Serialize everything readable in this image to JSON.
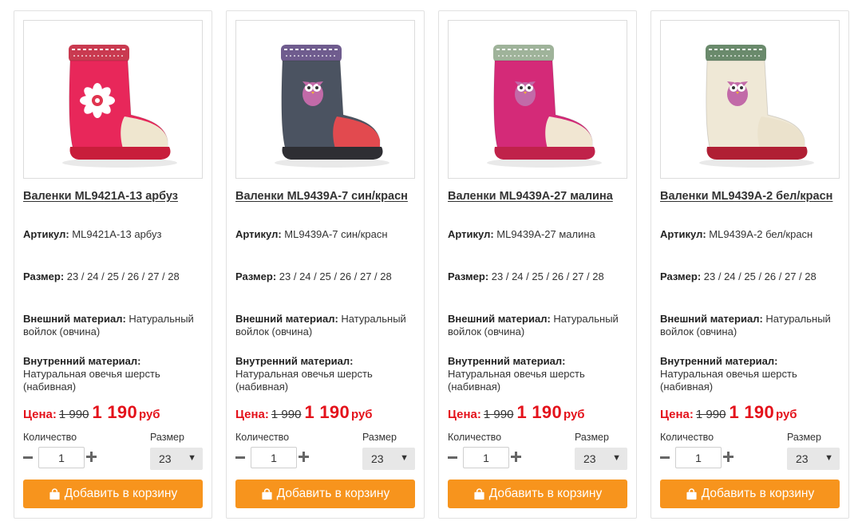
{
  "labels": {
    "article": "Артикул:",
    "size": "Размер:",
    "outer": "Внешний материал:",
    "inner": "Внутренний материал:",
    "price": "Цена:",
    "currency": "руб",
    "quantity": "Количество",
    "size_select": "Размер",
    "add_to_cart": "Добавить в корзину"
  },
  "colors": {
    "price_red": "#e4121b",
    "button_orange": "#f7941d"
  },
  "products": [
    {
      "title": "Валенки ML9421A-13 арбуз",
      "article": "ML9421A-13 арбуз",
      "sizes": "23 / 24 / 25 / 26 / 27 / 28",
      "outer": "Натуральный войлок (овчина)",
      "inner": "Натуральная овечья шерсть (набивная)",
      "old_price": "1 990",
      "new_price": "1 190",
      "quantity": "1",
      "selected_size": "23",
      "image": "pink boot with white flower",
      "boot_color": "#e8275a",
      "toe_color": "#efe6cf",
      "sole_color": "#c81e3b",
      "cuff_color": "#c93a50"
    },
    {
      "title": "Валенки ML9439A-7 син/красн",
      "article": "ML9439A-7 син/красн",
      "sizes": "23 / 24 / 25 / 26 / 27 / 28",
      "outer": "Натуральный войлок (овчина)",
      "inner": "Натуральная овечья шерсть (набивная)",
      "old_price": "1 990",
      "new_price": "1 190",
      "quantity": "1",
      "selected_size": "23",
      "image": "blue-grey boot with owl",
      "boot_color": "#4b5361",
      "toe_color": "#e24a4f",
      "sole_color": "#2e2e33",
      "cuff_color": "#6f5c8e"
    },
    {
      "title": "Валенки ML9439A-27 малина",
      "article": "ML9439A-27 малина",
      "sizes": "23 / 24 / 25 / 26 / 27 / 28",
      "outer": "Натуральный войлок (овчина)",
      "inner": "Натуральная овечья шерсть (набивная)",
      "old_price": "1 990",
      "new_price": "1 190",
      "quantity": "1",
      "selected_size": "23",
      "image": "raspberry boot with owl",
      "boot_color": "#d42a78",
      "toe_color": "#f1e6d2",
      "sole_color": "#c0224a",
      "cuff_color": "#9fb39a"
    },
    {
      "title": "Валенки ML9439A-2 бел/красн",
      "article": "ML9439A-2 бел/красн",
      "sizes": "23 / 24 / 25 / 26 / 27 / 28",
      "outer": "Натуральный войлок (овчина)",
      "inner": "Натуральная овечья шерсть (набивная)",
      "old_price": "1 990",
      "new_price": "1 190",
      "quantity": "1",
      "selected_size": "23",
      "image": "white boot with owl",
      "boot_color": "#efe8d6",
      "toe_color": "#ebe2cc",
      "sole_color": "#b01f34",
      "cuff_color": "#6a8a6c"
    }
  ]
}
